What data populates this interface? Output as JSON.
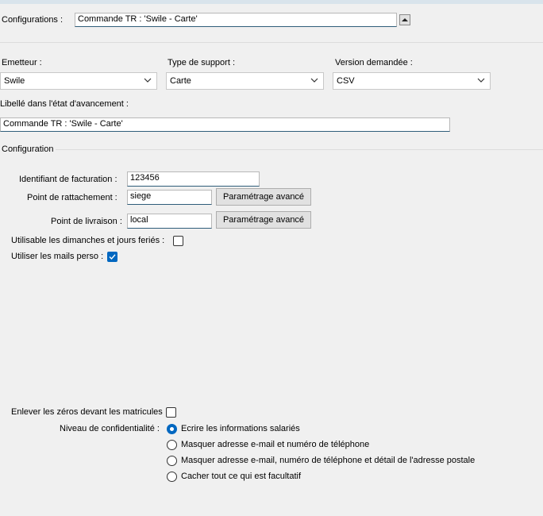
{
  "header": {
    "configurations_label": "Configurations :",
    "configurations_value": "Commande TR : 'Swile - Carte'"
  },
  "emetteur": {
    "label": "Emetteur :",
    "value": "Swile"
  },
  "type_support": {
    "label": "Type de support :",
    "value": "Carte"
  },
  "version": {
    "label": "Version demandée :",
    "value": "CSV"
  },
  "libelle": {
    "label": "Libellé dans l'état d'avancement :",
    "value": "Commande TR : 'Swile - Carte'"
  },
  "configuration_section": {
    "title": "Configuration",
    "identifiant_label": "Identifiant de facturation :",
    "identifiant_value": "123456",
    "rattachement_label": "Point de rattachement :",
    "rattachement_value": "siege",
    "livraison_label": "Point de livraison :",
    "livraison_value": "local",
    "advanced_button_label": "Paramétrage avancé",
    "dimanches_label": "Utilisable les dimanches et jours feriés :",
    "dimanches_checked": false,
    "mails_label": "Utiliser les mails perso :",
    "mails_checked": true
  },
  "bottom": {
    "zeros_label": "Enlever les zéros devant les matricules",
    "zeros_checked": false,
    "confidentialite_label": "Niveau de confidentialité :",
    "options": [
      "Ecrire les informations salariés",
      "Masquer adresse e-mail et numéro de téléphone",
      "Masquer adresse e-mail, numéro de téléphone et détail de l'adresse postale",
      "Cacher tout ce qui est facultatif"
    ],
    "selected_index": 0
  },
  "colors": {
    "accent": "#0067c0",
    "field_underline": "#2f5d7a"
  }
}
